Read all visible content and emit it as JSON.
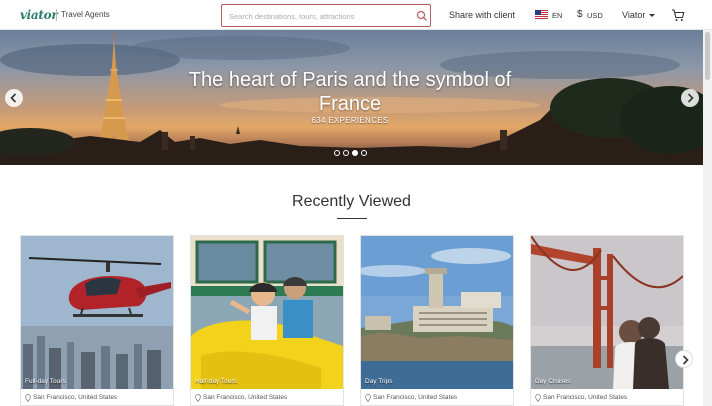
{
  "header": {
    "logo": "viator",
    "logo_sub": "Travel Agents",
    "search_placeholder": "Search destinations, tours, attractions",
    "share_label": "Share with client",
    "language": "EN",
    "currency_symbol": "$",
    "currency": "USD",
    "account_label": "Viator"
  },
  "hero": {
    "title": "The heart of Paris and the symbol of France",
    "subtitle": "634 EXPERIENCES",
    "slide_count": 4,
    "active_slide": 3
  },
  "recently_viewed": {
    "title": "Recently Viewed",
    "cards": [
      {
        "category": "Full-day Tours",
        "location": "San Francisco, United States",
        "image": "helicopter over city"
      },
      {
        "category": "Half-day Tours",
        "location": "San Francisco, United States",
        "image": "couple in yellow go-car"
      },
      {
        "category": "Day Trips",
        "location": "San Francisco, United States",
        "image": "alcatraz island"
      },
      {
        "category": "Day Cruises",
        "location": "San Francisco, United States",
        "image": "couple at golden gate bridge"
      }
    ]
  },
  "icons": {
    "search": "search-icon",
    "flag": "us-flag-icon",
    "cart": "cart-icon",
    "prev": "chevron-left-icon",
    "next": "chevron-right-icon",
    "pin": "location-pin-icon"
  },
  "colors": {
    "brand": "#2a7d6c",
    "search_border": "#b95c5c"
  }
}
